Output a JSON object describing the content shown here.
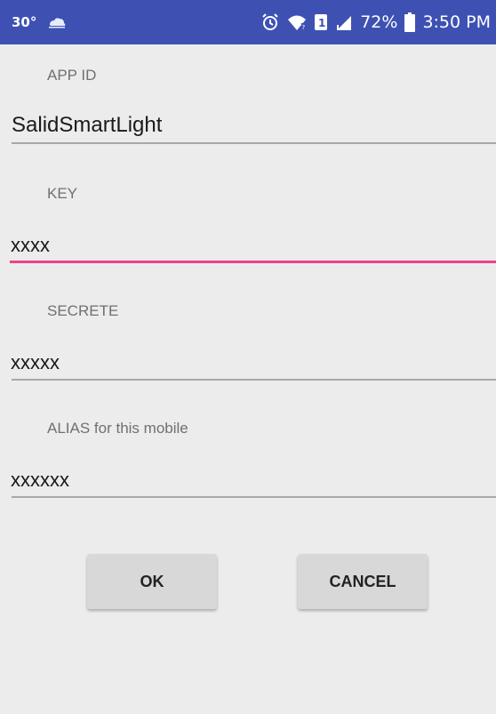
{
  "status_bar": {
    "temperature": "30°",
    "battery": "72%",
    "time": "3:50 PM",
    "background": "#3e51b3",
    "icons": [
      "weather-icon",
      "alarm-icon",
      "wifi-icon",
      "sim-icon",
      "signal-icon",
      "battery-icon"
    ]
  },
  "form": {
    "app_id": {
      "label": "APP ID",
      "value": "SalidSmartLight"
    },
    "key": {
      "label": "KEY",
      "value": "xxxx"
    },
    "secrete": {
      "label": "SECRETE",
      "value": "xxxxx"
    },
    "alias": {
      "label": "ALIAS for this mobile",
      "value": "xxxxxx"
    },
    "accent_color": "#f0428a"
  },
  "buttons": {
    "ok": "OK",
    "cancel": "CANCEL"
  }
}
